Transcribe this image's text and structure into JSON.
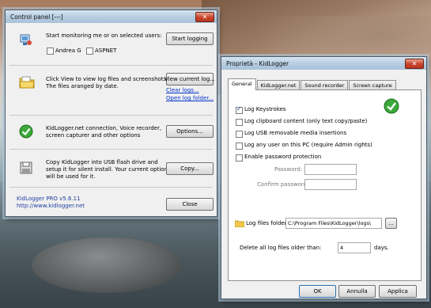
{
  "control_panel": {
    "title": "Control panel  [---]",
    "close_glyph": "✕",
    "sections": {
      "monitoring": {
        "text": "Start monitoring me or on selected users:",
        "users": [
          {
            "label": "Andrea G",
            "checked": false
          },
          {
            "label": "ASPNET",
            "checked": false
          }
        ],
        "button": "Start logging",
        "icon": "user-monitor-icon"
      },
      "logs": {
        "line1": "Click View to view log files and screenshots.",
        "line2": "The files aranged by date.",
        "button": "View current log...",
        "link1": "Clear logs...",
        "link2": "Open log folder...",
        "icon": "folder-icon"
      },
      "options": {
        "line1": "KidLogger.net connection, Voice recorder,",
        "line2": "screen capturer and other options",
        "button": "Options...",
        "icon": "green-check-icon"
      },
      "copy": {
        "line1": "Copy KidLogger into USB flash drive and",
        "line2": "setup it for silent install. Your current options",
        "line3": "will be used for it.",
        "button": "Copy...",
        "icon": "floppy-disk-icon"
      }
    },
    "footer": {
      "version": "KidLogger PRO v5.6.11",
      "url": "http://www.kidlogger.net",
      "close_button": "Close"
    }
  },
  "properties": {
    "title": "Proprietà - KidLogger",
    "close_glyph": "✕",
    "tabs": [
      "General",
      "KidLogger.net",
      "Sound recorder",
      "Screen capture"
    ],
    "active_tab": "General",
    "options": [
      {
        "label": "Log Keystrokes",
        "checked": true
      },
      {
        "label": "Log clipboard content (only text copy/paste)",
        "checked": false
      },
      {
        "label": "Log USB removable media insertions",
        "checked": false
      },
      {
        "label": "Log any user on this PC (require Admin rights)",
        "checked": false
      },
      {
        "label": "Enable password protection",
        "checked": false
      }
    ],
    "password_label": "Password:",
    "confirm_label": "Confirm password:",
    "log_folder_label": "Log files folder:",
    "log_folder_value": "C:\\Program Files\\KidLogger\\logs\\",
    "browse_button": "...",
    "delete_label": "Delete all log files older than:",
    "delete_days": "4",
    "days_label": "days.",
    "ok_button": "OK",
    "cancel_button": "Annulla",
    "apply_button": "Applica",
    "status_icon": "green-check-icon"
  }
}
